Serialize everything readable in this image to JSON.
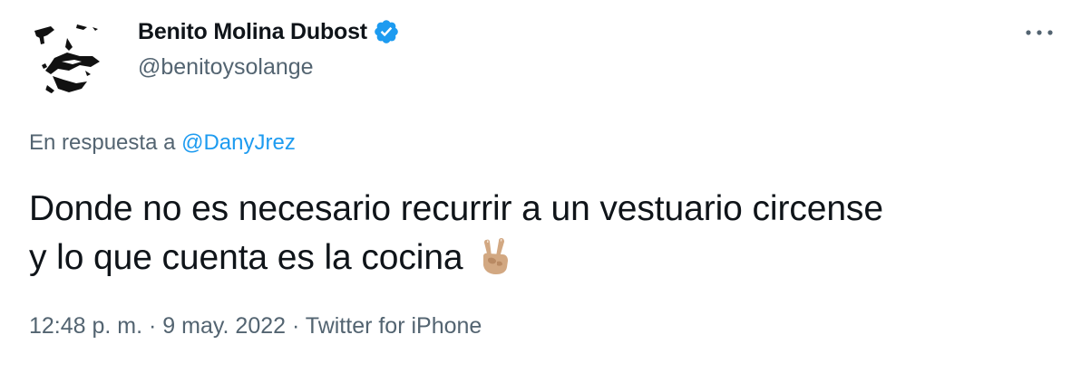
{
  "author": {
    "name": "Benito Molina Dubost",
    "handle": "@benitoysolange",
    "verified": true,
    "avatar_icon": "sketch-portrait-avatar"
  },
  "reply": {
    "prefix": "En respuesta a ",
    "to": "@DanyJrez"
  },
  "tweet": {
    "line1": "Donde no es necesario recurrir a un vestuario circense",
    "line2": "y lo que cuenta es la cocina",
    "emoji_icon": "victory-hand-emoji"
  },
  "meta": {
    "time": "12:48 p. m.",
    "separator": " · ",
    "date": "9 may. 2022",
    "source": "Twitter for iPhone"
  },
  "colors": {
    "text": "#0f1419",
    "secondary": "#536471",
    "link": "#1d9bf0",
    "verified_badge": "#1d9bf0"
  },
  "more_icon": "more-horizontal-icon"
}
